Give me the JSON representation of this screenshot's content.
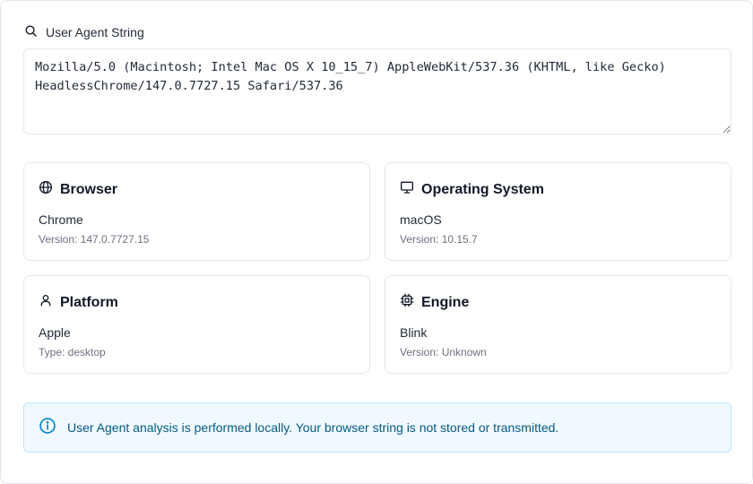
{
  "ua_section": {
    "label": "User Agent String",
    "value": "Mozilla/5.0 (Macintosh; Intel Mac OS X 10_15_7) AppleWebKit/537.36 (KHTML, like Gecko) HeadlessChrome/147.0.7727.15 Safari/537.36"
  },
  "cards": {
    "browser": {
      "title": "Browser",
      "value": "Chrome",
      "meta": "Version: 147.0.7727.15",
      "icon": "globe-icon"
    },
    "os": {
      "title": "Operating System",
      "value": "macOS",
      "meta": "Version: 10.15.7",
      "icon": "monitor-icon"
    },
    "platform": {
      "title": "Platform",
      "value": "Apple",
      "meta": "Type: desktop",
      "icon": "user-icon"
    },
    "engine": {
      "title": "Engine",
      "value": "Blink",
      "meta": "Version: Unknown",
      "icon": "cpu-icon"
    }
  },
  "notice": {
    "text": "User Agent analysis is performed locally. Your browser string is not stored or transmitted.",
    "icon": "info-icon"
  },
  "colors": {
    "notice_bg": "#f0f9ff",
    "notice_border": "#bae6fd",
    "notice_text": "#075985",
    "card_border": "#e5e7eb"
  }
}
